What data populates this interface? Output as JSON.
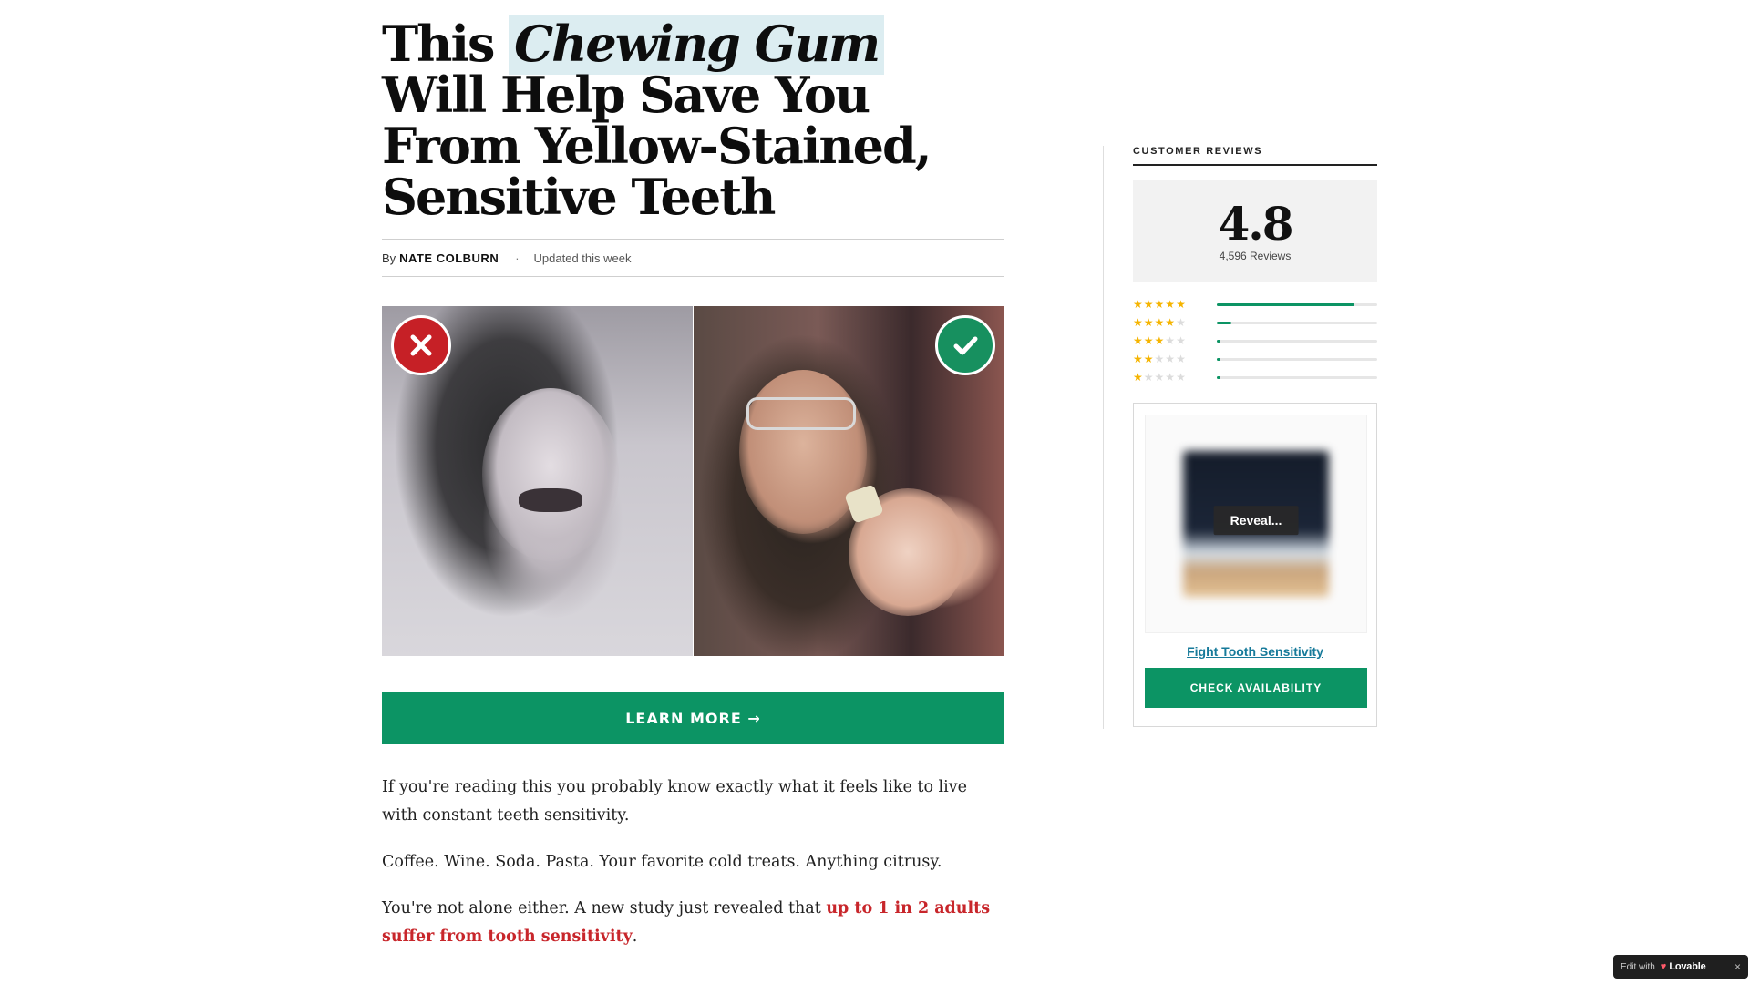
{
  "article": {
    "headline_pre": "This ",
    "headline_highlight": "Chewing Gum",
    "headline_post": "Will Help Save You From Yellow-Stained, Sensitive Teeth",
    "byline_prefix": "By",
    "author": "NATE COLBURN",
    "separator": "·",
    "updated": "Updated this week",
    "cta_label": "LEARN MORE →",
    "paragraphs": {
      "p1": "If you're reading this you probably know exactly what it feels like to live with constant teeth sensitivity.",
      "p2": "Coffee. Wine. Soda. Pasta. Your favorite cold treats. Anything citrusy.",
      "p3_pre": "You're not alone either. A new study just revealed that ",
      "p3_accent": "up to 1 in 2 adults suffer from tooth sensitivity",
      "p3_post": "."
    },
    "hero_badges": {
      "left_icon": "x-icon",
      "right_icon": "checkmark-icon",
      "left_color": "#c62026",
      "right_color": "#17905f"
    }
  },
  "sidebar": {
    "title": "CUSTOMER REVIEWS",
    "rating": "4.8",
    "review_count": "4,596 Reviews",
    "distribution": [
      {
        "stars": 5,
        "fraction": 0.86
      },
      {
        "stars": 4,
        "fraction": 0.09
      },
      {
        "stars": 3,
        "fraction": 0.02
      },
      {
        "stars": 2,
        "fraction": 0.01
      },
      {
        "stars": 1,
        "fraction": 0.01
      }
    ],
    "product": {
      "reveal_label": "Reveal...",
      "link_label": "Fight Tooth Sensitivity",
      "button_label": "CHECK AVAILABILITY"
    }
  },
  "chip": {
    "edit_label": "Edit with",
    "brand": "Lovable",
    "close": "×"
  },
  "colors": {
    "accent_green": "#0c9464",
    "accent_red": "#c8262b",
    "highlight_bg": "#dcedf1",
    "star_yellow": "#f5b400",
    "link_blue": "#167a9a"
  }
}
